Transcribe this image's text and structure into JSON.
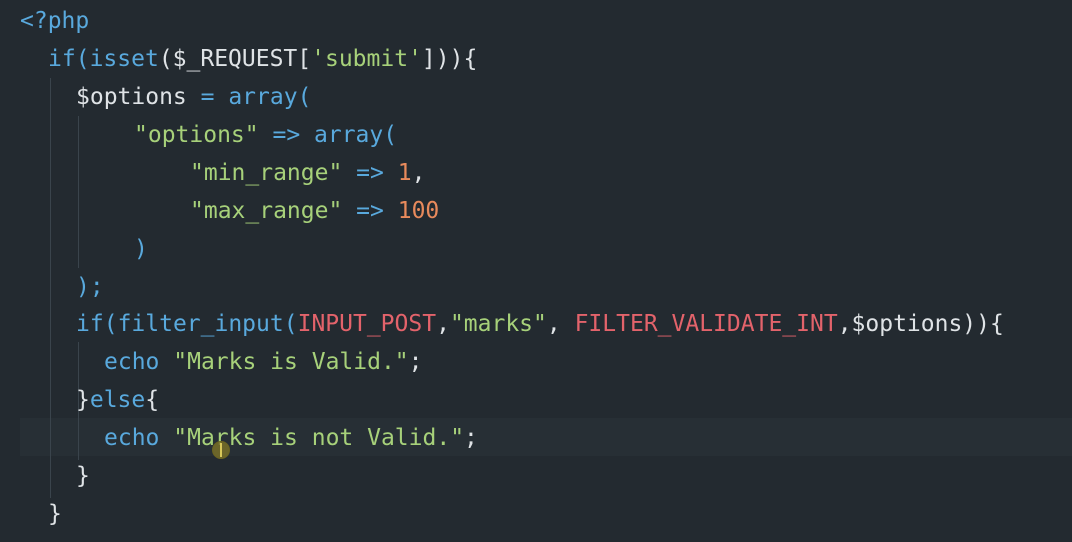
{
  "editor": {
    "lines": [
      [
        {
          "t": "<?php",
          "c": "kw"
        }
      ],
      [
        {
          "t": "if",
          "c": "kw"
        },
        {
          "t": "(",
          "c": "punc"
        },
        {
          "t": "isset",
          "c": "kw"
        },
        {
          "t": "($_REQUEST[",
          "c": "plain"
        },
        {
          "t": "'submit'",
          "c": "str"
        },
        {
          "t": "])){",
          "c": "plain"
        }
      ],
      [
        {
          "t": "$options",
          "c": "var"
        },
        {
          "t": " = ",
          "c": "kw"
        },
        {
          "t": "array",
          "c": "kw"
        },
        {
          "t": "(",
          "c": "kw"
        }
      ],
      [
        {
          "t": "\"options\"",
          "c": "str"
        },
        {
          "t": " => ",
          "c": "kw"
        },
        {
          "t": "array",
          "c": "kw"
        },
        {
          "t": "(",
          "c": "kw"
        }
      ],
      [
        {
          "t": "\"min_range\"",
          "c": "str"
        },
        {
          "t": " => ",
          "c": "kw"
        },
        {
          "t": "1",
          "c": "num"
        },
        {
          "t": ",",
          "c": "plain"
        }
      ],
      [
        {
          "t": "\"max_range\"",
          "c": "str"
        },
        {
          "t": " => ",
          "c": "kw"
        },
        {
          "t": "100",
          "c": "num"
        }
      ],
      [
        {
          "t": ")",
          "c": "kw"
        }
      ],
      [
        {
          "t": ");",
          "c": "kw"
        }
      ],
      [
        {
          "t": "if",
          "c": "kw"
        },
        {
          "t": "(",
          "c": "kw"
        },
        {
          "t": "filter_input",
          "c": "kw"
        },
        {
          "t": "(",
          "c": "kw"
        },
        {
          "t": "INPUT_POST",
          "c": "const"
        },
        {
          "t": ",",
          "c": "plain"
        },
        {
          "t": "\"marks\"",
          "c": "str"
        },
        {
          "t": ", ",
          "c": "plain"
        },
        {
          "t": "FILTER_VALIDATE_INT",
          "c": "const"
        },
        {
          "t": ",$options)){",
          "c": "plain"
        }
      ],
      [
        {
          "t": "echo",
          "c": "kw"
        },
        {
          "t": " ",
          "c": "plain"
        },
        {
          "t": "\"Marks is Valid.\"",
          "c": "str"
        },
        {
          "t": ";",
          "c": "plain"
        }
      ],
      [
        {
          "t": "}",
          "c": "plain"
        },
        {
          "t": "else",
          "c": "kw"
        },
        {
          "t": "{",
          "c": "plain"
        }
      ],
      [
        {
          "t": "echo",
          "c": "kw"
        },
        {
          "t": " ",
          "c": "plain"
        },
        {
          "t": "\"Marks is not Valid.\"",
          "c": "str"
        },
        {
          "t": ";",
          "c": "plain"
        }
      ],
      [
        {
          "t": "}",
          "c": "plain"
        }
      ],
      [
        {
          "t": "}",
          "c": "plain"
        }
      ]
    ]
  },
  "colors": {
    "background": "#232a30",
    "keyword": "#59a9dd",
    "string": "#a7d17a",
    "number": "#e88a5c",
    "constant": "#e3636b",
    "text": "#dfe3e6"
  }
}
